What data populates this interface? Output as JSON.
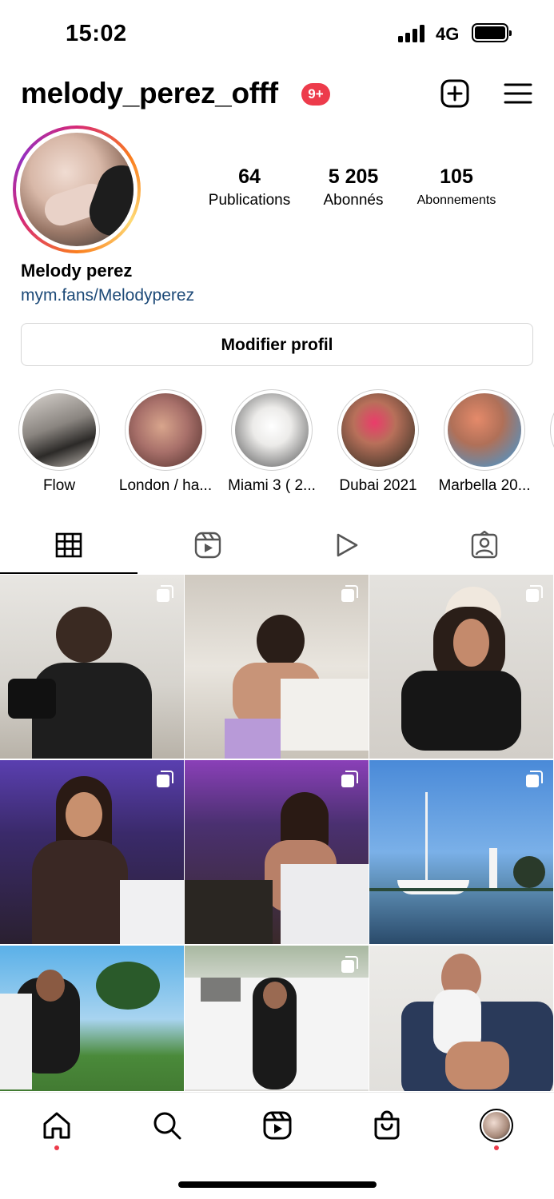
{
  "status_bar": {
    "time": "15:02",
    "network": "4G",
    "signal_bars": 4,
    "battery_level": 1.0
  },
  "header": {
    "username": "melody_perez_offf",
    "notification_badge": "9+",
    "create_icon": "plus-square-icon",
    "menu_icon": "hamburger-menu-icon"
  },
  "profile": {
    "posts_count": "64",
    "posts_label": "Publications",
    "followers_count": "5 205",
    "followers_label": "Abonnés",
    "following_count": "105",
    "following_label": "Abonnements",
    "display_name": "Melody perez",
    "bio_link": "mym.fans/Melodyperez",
    "edit_button_label": "Modifier profil"
  },
  "highlights": [
    {
      "label": "Flow"
    },
    {
      "label": "London / ha..."
    },
    {
      "label": "Miami 3 ( 2..."
    },
    {
      "label": "Dubai 2021"
    },
    {
      "label": "Marbella 20..."
    }
  ],
  "tabs": [
    {
      "icon": "grid-icon",
      "active": true
    },
    {
      "icon": "reels-icon",
      "active": false
    },
    {
      "icon": "play-icon",
      "active": false
    },
    {
      "icon": "tagged-icon",
      "active": false
    }
  ],
  "bottom_nav": [
    {
      "icon": "home-icon",
      "dot": true
    },
    {
      "icon": "search-icon",
      "dot": false
    },
    {
      "icon": "reels-icon",
      "dot": false
    },
    {
      "icon": "shop-icon",
      "dot": false
    },
    {
      "icon": "profile-avatar-icon",
      "dot": true
    }
  ],
  "colors": {
    "accent_red": "#ed3b4b",
    "link_blue": "#1d4a78",
    "border_gray": "#d6d6d6"
  }
}
